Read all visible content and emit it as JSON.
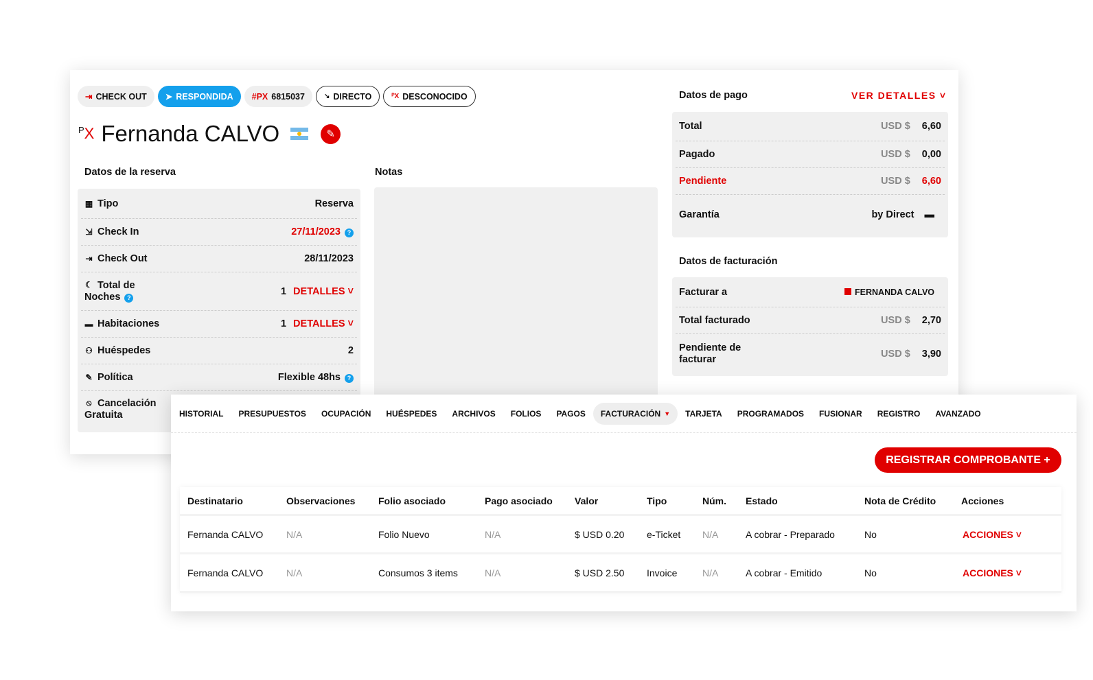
{
  "header": {
    "chips": [
      {
        "icon": "check-out-icon",
        "label": "CHECK OUT"
      },
      {
        "icon": "send-icon",
        "label": "RESPONDIDA"
      },
      {
        "prefix": "#PX",
        "label": "6815037"
      },
      {
        "icon": "arrow-down-right-icon",
        "label": "DIRECTO"
      },
      {
        "icon": "px-logo-icon",
        "label": "DESCONOCIDO"
      }
    ],
    "logo": "PX",
    "guest_name": "Fernanda CALVO",
    "flag": "argentina-flag-icon"
  },
  "reserva": {
    "title": "Datos de la reserva",
    "rows": [
      {
        "icon": "calendar-icon",
        "label": "Tipo",
        "value": "Reserva"
      },
      {
        "icon": "login-icon",
        "label": "Check In",
        "value": "27/11/2023"
      },
      {
        "icon": "logout-icon",
        "label": "Check Out",
        "value": "28/11/2023"
      },
      {
        "icon": "moon-icon",
        "label": "Total de Noches",
        "value": "1",
        "link": "DETALLES"
      },
      {
        "icon": "bed-icon",
        "label": "Habitaciones",
        "value": "1",
        "link": "DETALLES"
      },
      {
        "icon": "users-icon",
        "label": "Huéspedes",
        "value": "2"
      },
      {
        "icon": "policy-icon",
        "label": "Política",
        "value": "Flexible 48hs"
      },
      {
        "icon": "ban-icon",
        "label": "Cancelación Gratuita",
        "value": ""
      }
    ]
  },
  "notas": {
    "title": "Notas"
  },
  "pago": {
    "title": "Datos de pago",
    "link": "VER DETALLES",
    "rows": [
      {
        "label": "Total",
        "currency": "USD $",
        "value": "6,60"
      },
      {
        "label": "Pagado",
        "currency": "USD $",
        "value": "0,00"
      },
      {
        "label": "Pendiente",
        "currency": "USD $",
        "value": "6,60"
      },
      {
        "label": "Garantía",
        "value": "by Direct"
      }
    ]
  },
  "facturacion": {
    "title": "Datos de facturación",
    "rows": [
      {
        "label": "Facturar a",
        "value": "FERNANDA CALVO"
      },
      {
        "label": "Total facturado",
        "currency": "USD $",
        "value": "2,70"
      },
      {
        "label": "Pendiente de facturar",
        "currency": "USD $",
        "value": "3,90"
      }
    ]
  },
  "tabs": [
    "HISTORIAL",
    "PRESUPUESTOS",
    "OCUPACIÓN",
    "HUÉSPEDES",
    "ARCHIVOS",
    "FOLIOS",
    "PAGOS",
    "FACTURACIÓN",
    "TARJETA",
    "PROGRAMADOS",
    "FUSIONAR",
    "REGISTRO",
    "AVANZADO"
  ],
  "active_tab": "FACTURACIÓN",
  "register_button": "REGISTRAR COMPROBANTE +",
  "table": {
    "columns": [
      "Destinatario",
      "Observaciones",
      "Folio asociado",
      "Pago asociado",
      "Valor",
      "Tipo",
      "Núm.",
      "Estado",
      "Nota de Crédito",
      "Acciones"
    ],
    "rows": [
      [
        "Fernanda CALVO",
        "N/A",
        "Folio Nuevo",
        "N/A",
        "$ USD 0.20",
        "e-Ticket",
        "N/A",
        "A cobrar - Preparado",
        "No",
        "ACCIONES"
      ],
      [
        "Fernanda CALVO",
        "N/A",
        "Consumos 3 items",
        "N/A",
        "$ USD 2.50",
        "Invoice",
        "N/A",
        "A cobrar - Emitido",
        "No",
        "ACCIONES"
      ]
    ]
  },
  "colors": {
    "accent": "#e00000",
    "blue": "#14a0ec"
  }
}
